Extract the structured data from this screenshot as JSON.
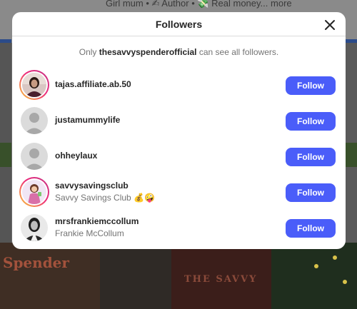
{
  "background": {
    "top_text": "Girl mum • ✍ Author • 💸 Real money... more",
    "tile_text_a": "Spender",
    "tile_text_b": "THE SAVVY"
  },
  "modal": {
    "title": "Followers",
    "close_icon": "close-icon",
    "notice": {
      "prefix": "Only ",
      "account": "thesavvyspenderofficial",
      "suffix": " can see all followers."
    }
  },
  "followers": [
    {
      "username": "tajas.affiliate.ab.50",
      "full_name": "",
      "avatar": "photo-avatar",
      "story_ring": true,
      "button": "Follow"
    },
    {
      "username": "justamummylife",
      "full_name": "",
      "avatar": "default-avatar",
      "story_ring": false,
      "button": "Follow"
    },
    {
      "username": "ohheylaux",
      "full_name": "",
      "avatar": "default-avatar",
      "story_ring": false,
      "button": "Follow"
    },
    {
      "username": "savvysavingsclub",
      "full_name": "Savvy Savings Club 💰🤪",
      "avatar": "cartoon-avatar",
      "story_ring": true,
      "button": "Follow"
    },
    {
      "username": "mrsfrankiemccollum",
      "full_name": "Frankie McCollum",
      "avatar": "photo-avatar",
      "story_ring": false,
      "button": "Follow"
    }
  ],
  "colors": {
    "follow_button": "#4a5df9",
    "primary_text": "#262626",
    "secondary_text": "#737373"
  }
}
